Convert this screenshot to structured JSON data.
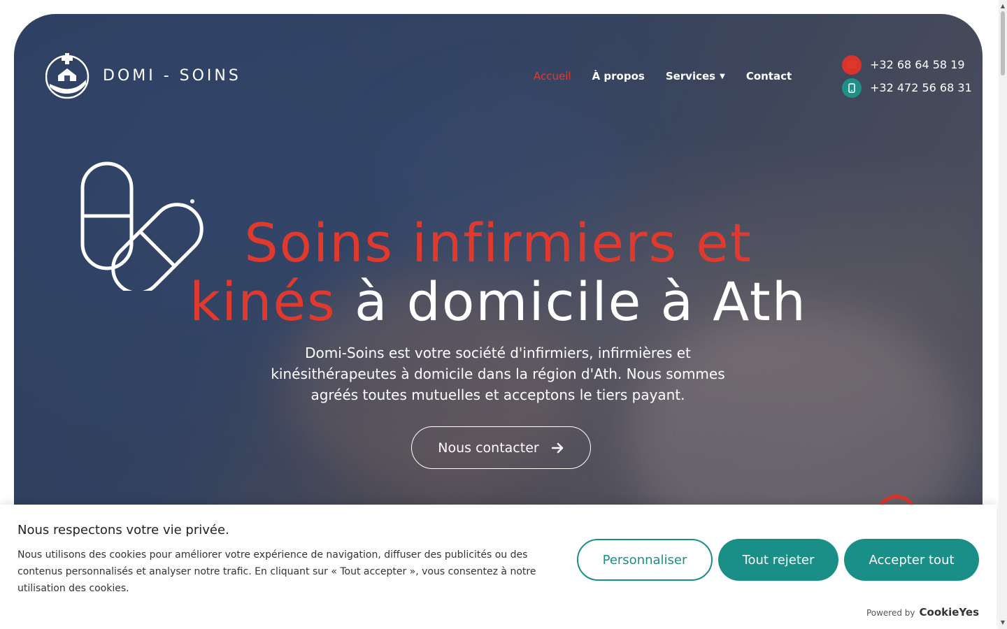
{
  "brand": {
    "name": "DOMI - SOINS"
  },
  "nav": {
    "items": [
      {
        "label": "Accueil",
        "active": true
      },
      {
        "label": "À propos",
        "active": false
      },
      {
        "label": "Services",
        "active": false,
        "has_dropdown": true
      },
      {
        "label": "Contact",
        "active": false
      }
    ]
  },
  "contacts": {
    "phone_fixed": "+32 68 64 58 19",
    "phone_mobile": "+32 472 56 68 31"
  },
  "hero": {
    "title_part1_red": "Soins infirmiers et",
    "title_part2_red": "kinés",
    "title_part3_white": "à domicile à Ath",
    "lead": "Domi-Soins est votre société d'infirmiers, infirmières et kinésithérapeutes à domicile dans la région d'Ath. Nous sommes agréés toutes mutuelles et acceptons le tiers payant.",
    "cta_label": "Nous contacter"
  },
  "cookie": {
    "title": "Nous respectons votre vie privée.",
    "text": "Nous utilisons des cookies pour améliorer votre expérience de navigation, diffuser des publicités ou des contenus personnalisés et analyser notre trafic. En cliquant sur « Tout accepter », vous consentez à notre utilisation des cookies.",
    "customize_label": "Personnaliser",
    "reject_label": "Tout rejeter",
    "accept_label": "Accepter tout",
    "powered_by": "Powered by",
    "powered_brand": "CookieYes"
  },
  "colors": {
    "accent_red": "#e03a2f",
    "accent_teal": "#1a8f87"
  },
  "icons": {
    "phone": "phone-icon",
    "mobile": "mobile-icon",
    "arrow": "arrow-right-icon",
    "chevron": "chevron-down-icon",
    "pills": "pills-icon",
    "logo": "home-care-logo-icon"
  }
}
